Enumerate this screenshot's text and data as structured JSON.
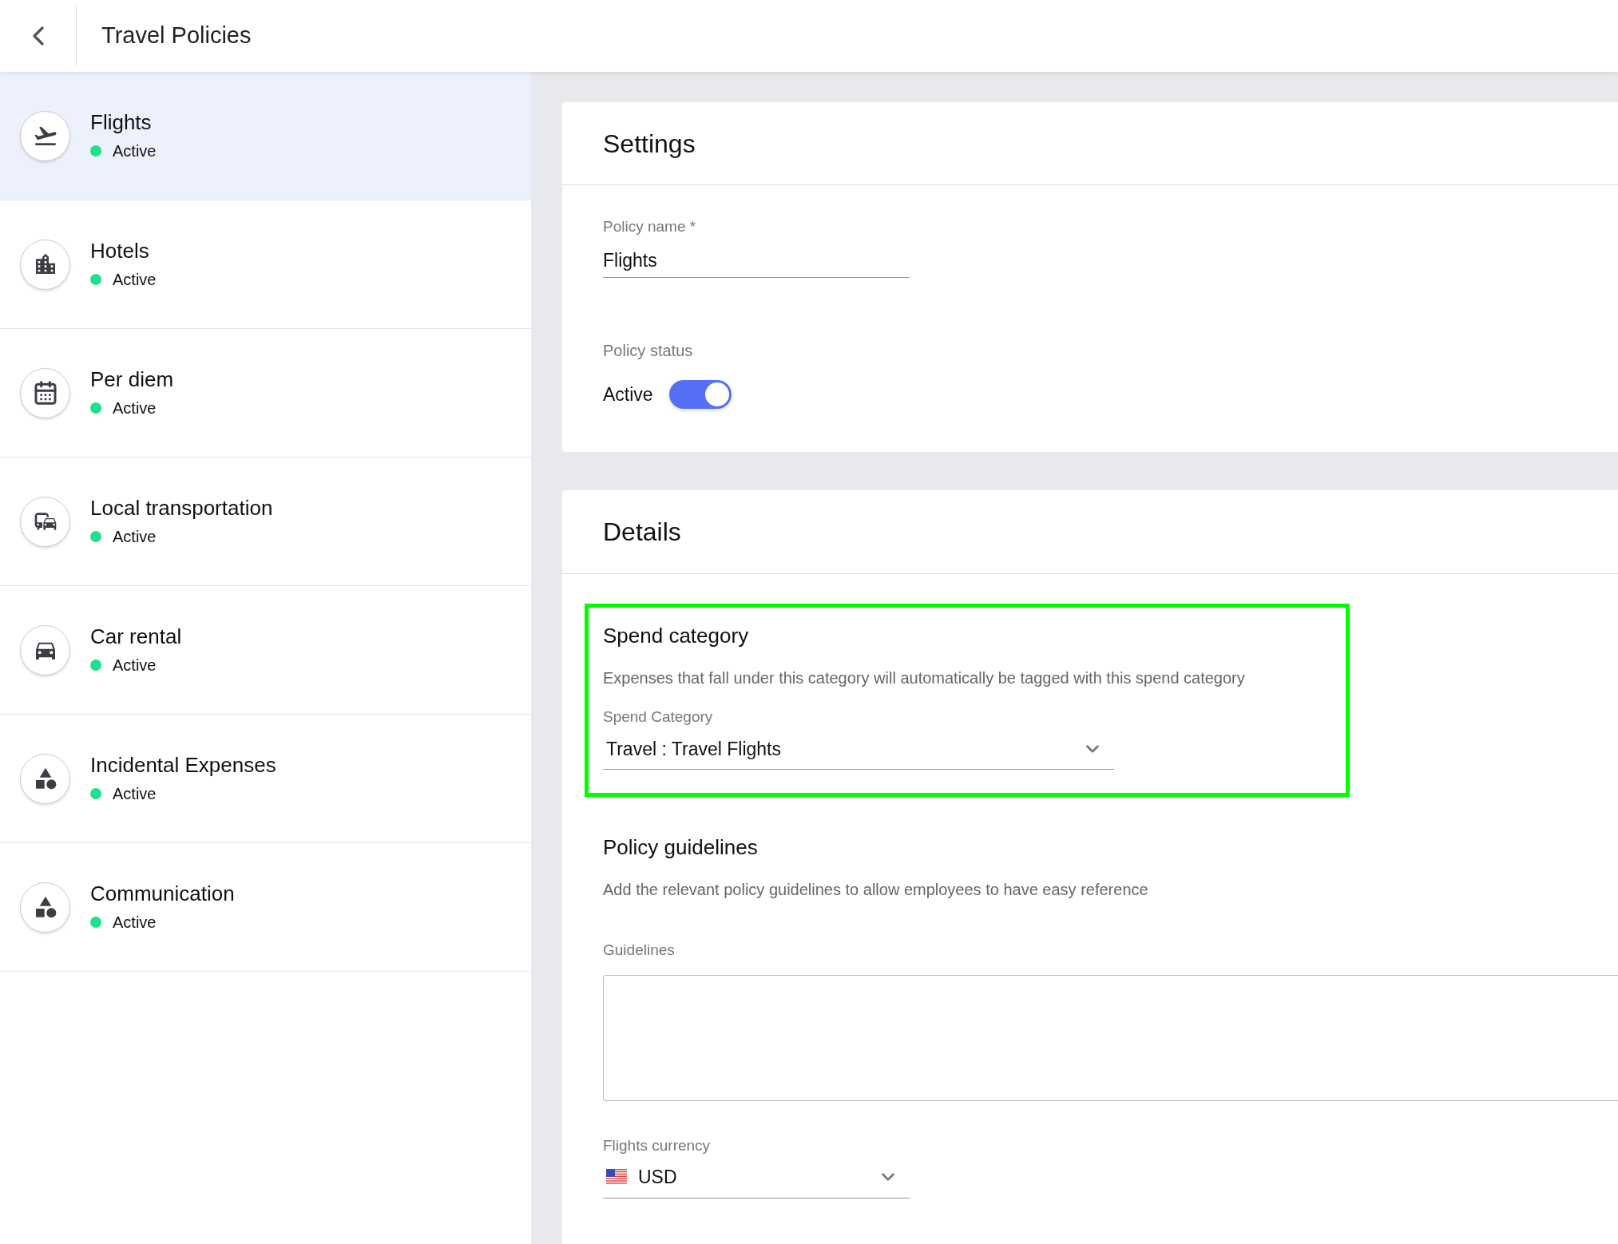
{
  "header": {
    "title": "Travel Policies"
  },
  "policies": [
    {
      "name": "Flights",
      "status": "Active",
      "active": true,
      "selected": true
    },
    {
      "name": "Hotels",
      "status": "Active",
      "active": true,
      "selected": false
    },
    {
      "name": "Per diem",
      "status": "Active",
      "active": true,
      "selected": false
    },
    {
      "name": "Local transportation",
      "status": "Active",
      "active": true,
      "selected": false
    },
    {
      "name": "Car rental",
      "status": "Active",
      "active": true,
      "selected": false
    },
    {
      "name": "Incidental Expenses",
      "status": "Active",
      "active": true,
      "selected": false
    },
    {
      "name": "Communication",
      "status": "Active",
      "active": true,
      "selected": false
    }
  ],
  "settings": {
    "heading": "Settings",
    "policy_name": {
      "label": "Policy name *",
      "value": "Flights"
    },
    "policy_status": {
      "label": "Policy status",
      "toggle_label": "Active",
      "on": true
    }
  },
  "details": {
    "heading": "Details",
    "spend_category": {
      "heading": "Spend category",
      "description": "Expenses that fall under this category will automatically be tagged with this spend category",
      "label": "Spend Category",
      "value": "Travel : Travel Flights"
    },
    "guidelines": {
      "heading": "Policy guidelines",
      "description": "Add the relevant policy guidelines to allow employees to have easy reference",
      "label": "Guidelines"
    },
    "currency": {
      "label": "Flights currency",
      "value": "USD"
    }
  }
}
